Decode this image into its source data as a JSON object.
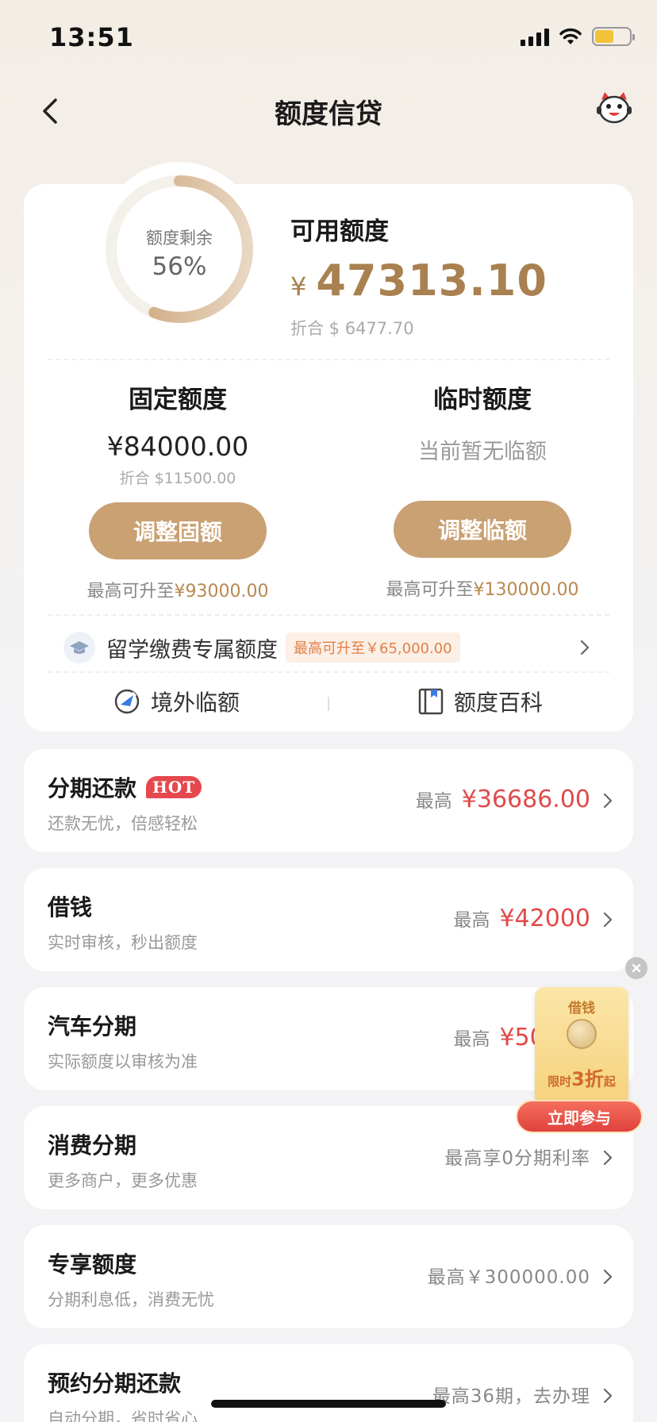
{
  "status_bar": {
    "time": "13:51"
  },
  "nav": {
    "title": "额度信贷"
  },
  "summary": {
    "ring_label": "额度剩余",
    "ring_value": "56%",
    "remaining_fraction": 0.56,
    "available_label": "可用额度",
    "currency_symbol": "¥",
    "available_amount": "47313.10",
    "available_usd": "折合 $ 6477.70"
  },
  "fixed": {
    "title": "固定额度",
    "amount": "¥84000.00",
    "usd": "折合 $11500.00",
    "button": "调整固额",
    "max_prefix": "最高可升至",
    "max_value": "¥93000.00"
  },
  "temporary": {
    "title": "临时额度",
    "empty_text": "当前暂无临额",
    "button": "调整临额",
    "max_prefix": "最高可升至",
    "max_value": "¥130000.00"
  },
  "study": {
    "label": "留学缴费专属额度",
    "badge": "最高可升至￥65,000.00"
  },
  "links": {
    "overseas": "境外临额",
    "encyclopedia": "额度百科"
  },
  "products": [
    {
      "title": "分期还款",
      "badge": "HOT",
      "subtitle": "还款无忧，倍感轻松",
      "prefix": "最高",
      "amount": "¥36686.00"
    },
    {
      "title": "借钱",
      "subtitle": "实时审核，秒出额度",
      "prefix": "最高",
      "amount": "¥42000"
    },
    {
      "title": "汽车分期",
      "subtitle": "实际额度以审核为准",
      "prefix": "最高",
      "amount": "¥50000"
    },
    {
      "title": "消费分期",
      "subtitle": "更多商户，更多优惠",
      "text": "最高享0分期利率"
    },
    {
      "title": "专享额度",
      "subtitle": "分期利息低，消费无忧",
      "text": "最高￥300000.00"
    },
    {
      "title": "预约分期还款",
      "subtitle": "自动分期，省时省心",
      "text": "最高36期，去办理"
    }
  ],
  "promo": {
    "title": "借钱",
    "discount_prefix": "限时",
    "discount_big": "3折",
    "discount_suffix": "起",
    "button": "立即参与"
  },
  "colors": {
    "gold": "#c9a173",
    "accent_amount": "#a9804f",
    "red": "#e14a4a"
  }
}
